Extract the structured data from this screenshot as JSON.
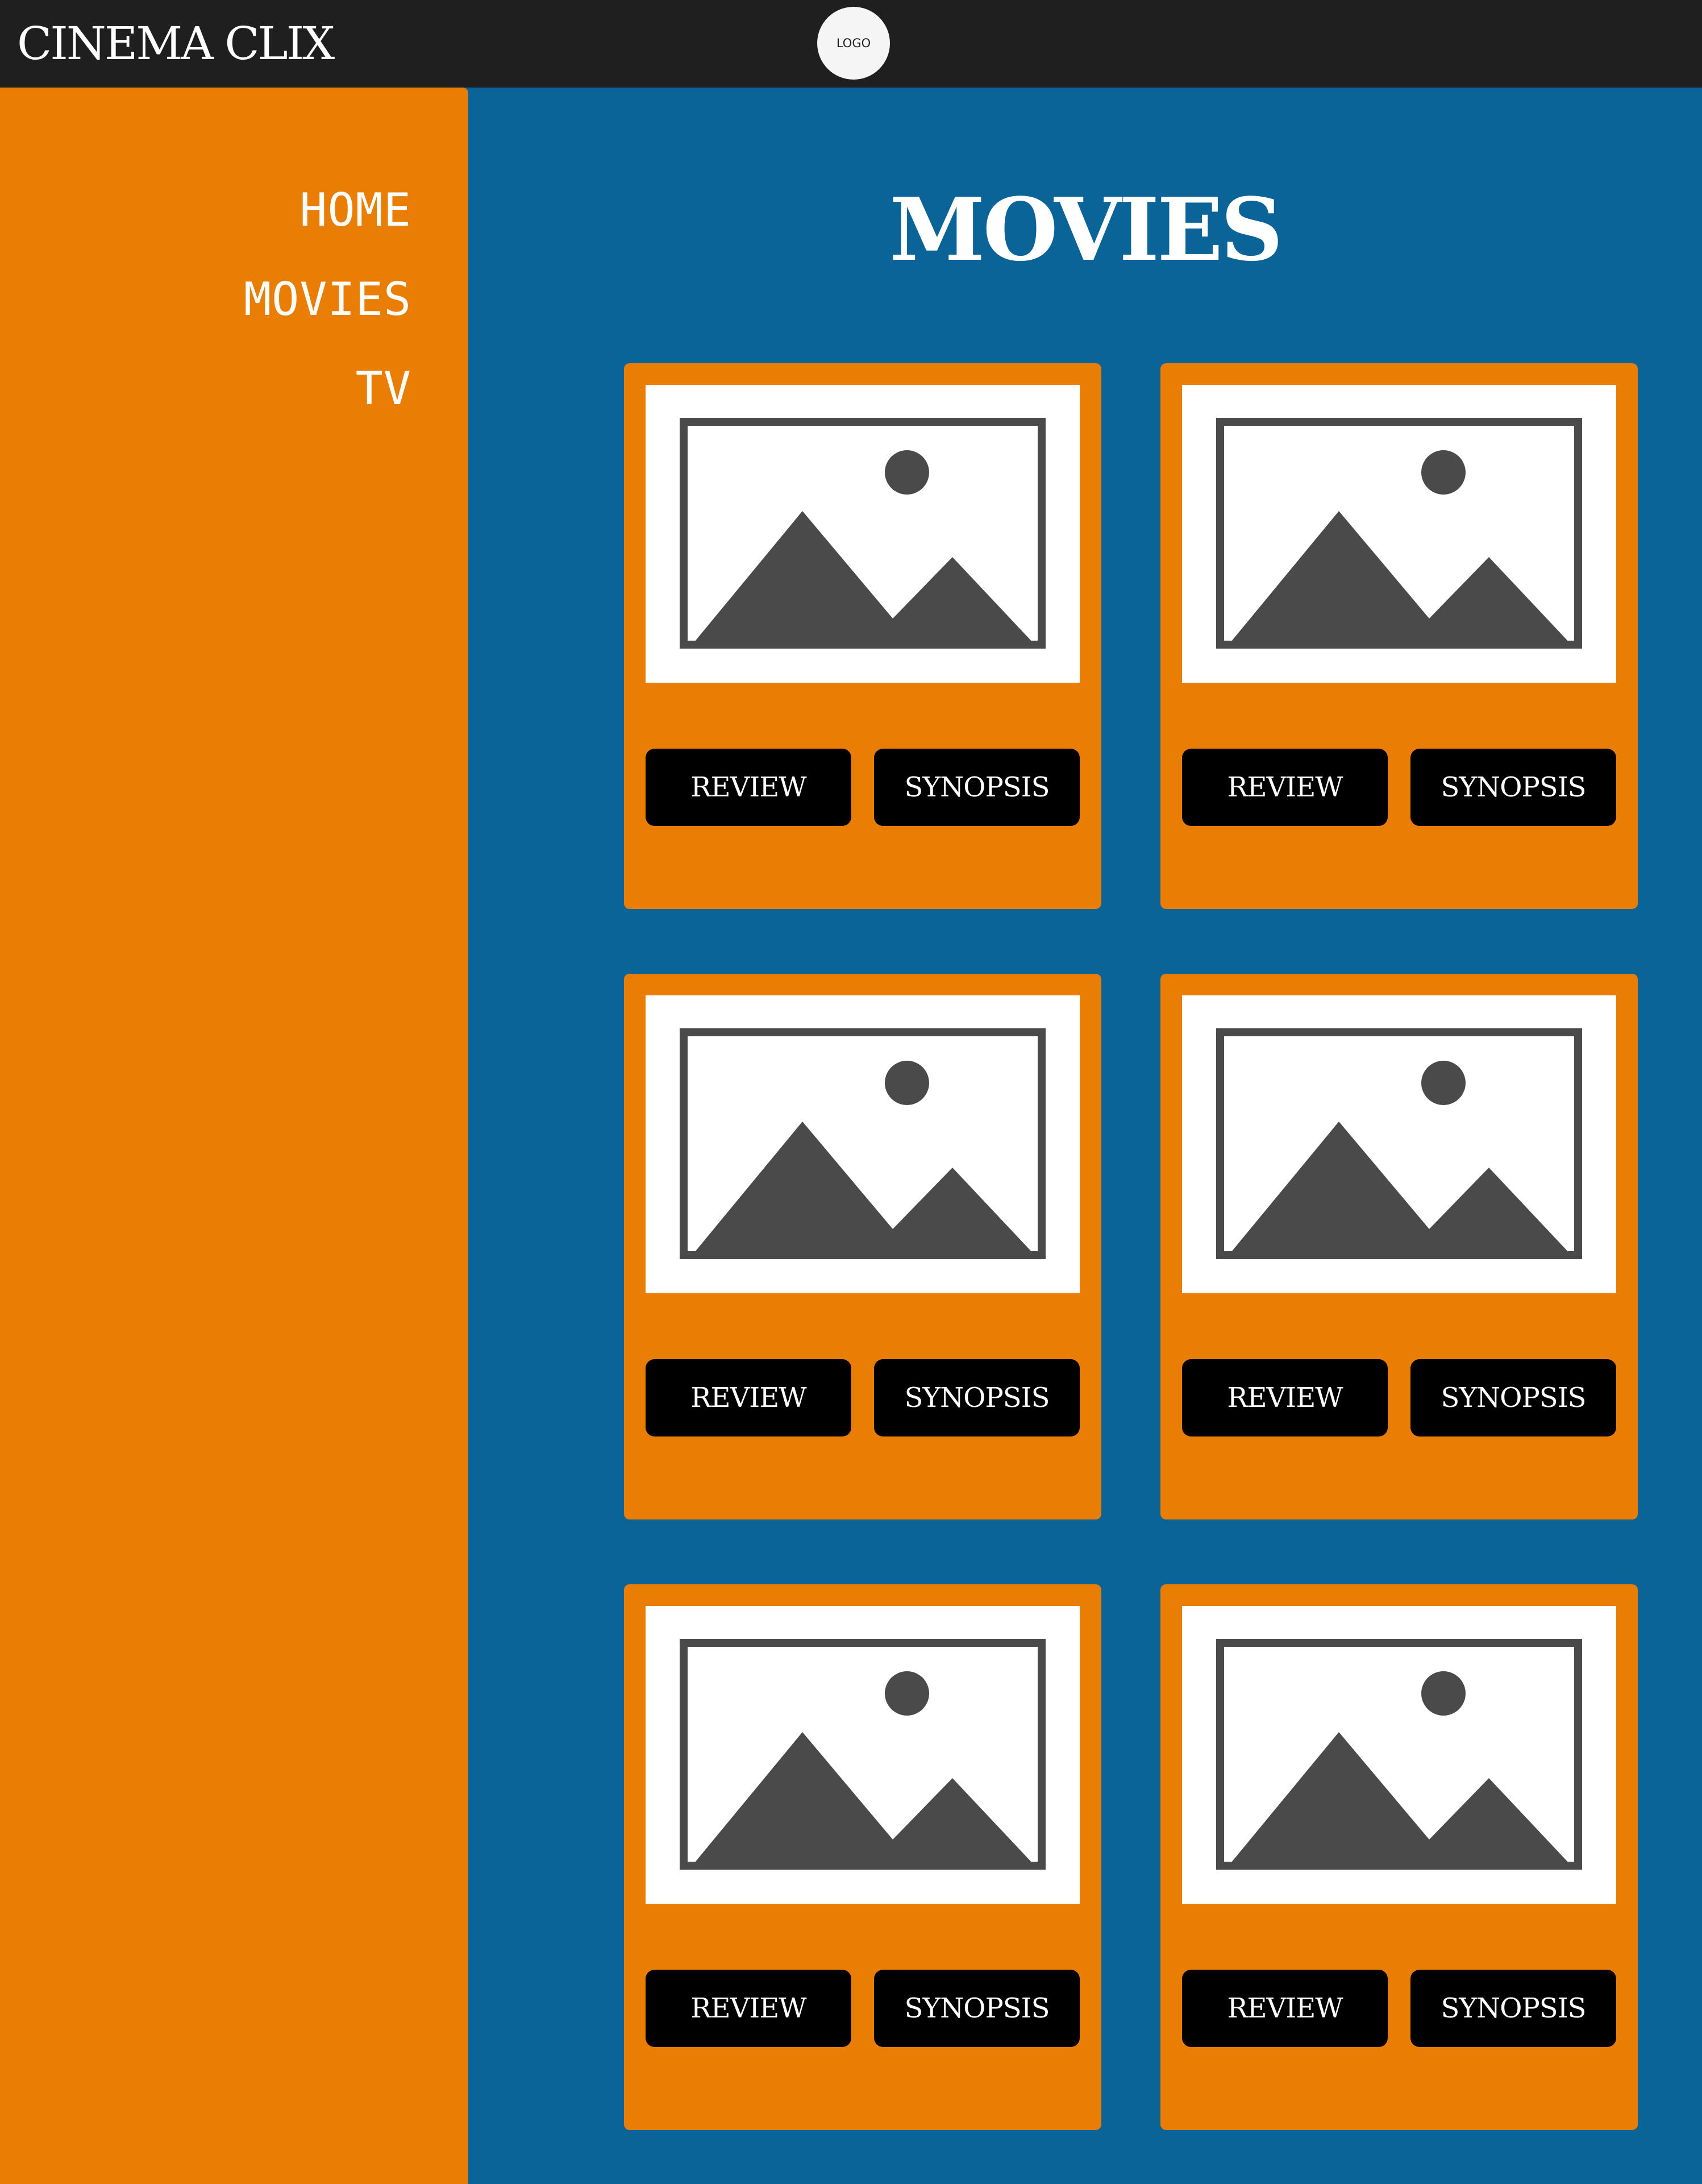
{
  "header": {
    "brand": "CINEMA CLIX",
    "logo_text": "LOGO"
  },
  "sidebar": {
    "items": [
      {
        "label": "HOME"
      },
      {
        "label": "MOVIES"
      },
      {
        "label": "TV"
      }
    ]
  },
  "main": {
    "title": "MOVIES",
    "cards": [
      {
        "image_icon": "image-placeholder-icon",
        "review_label": "REVIEW",
        "synopsis_label": "SYNOPSIS"
      },
      {
        "image_icon": "image-placeholder-icon",
        "review_label": "REVIEW",
        "synopsis_label": "SYNOPSIS"
      },
      {
        "image_icon": "image-placeholder-icon",
        "review_label": "REVIEW",
        "synopsis_label": "SYNOPSIS"
      },
      {
        "image_icon": "image-placeholder-icon",
        "review_label": "REVIEW",
        "synopsis_label": "SYNOPSIS"
      },
      {
        "image_icon": "image-placeholder-icon",
        "review_label": "REVIEW",
        "synopsis_label": "SYNOPSIS"
      },
      {
        "image_icon": "image-placeholder-icon",
        "review_label": "REVIEW",
        "synopsis_label": "SYNOPSIS"
      }
    ]
  },
  "colors": {
    "topbar": "#1f1f20",
    "sidebar": "#ea7d04",
    "main_bg": "#0b6498",
    "card": "#ea7d04",
    "button": "#000000",
    "icon": "#4a4a4a"
  }
}
